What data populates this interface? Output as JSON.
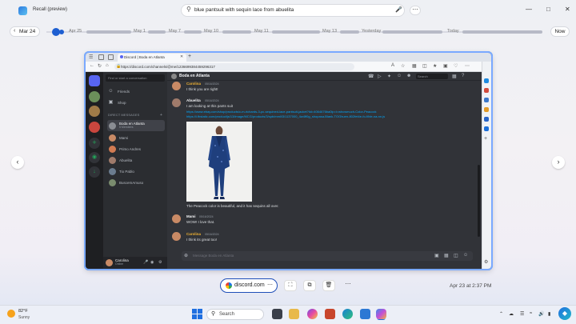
{
  "recall": {
    "app_title": "Recall (preview)",
    "search_query": "blue pantsuit with sequin lace from abuelita",
    "window_controls": [
      "minimize",
      "restore",
      "close"
    ]
  },
  "timeline": {
    "back_label": "Mar 24",
    "labels": [
      "Apr 25",
      "May 1",
      "May 7",
      "May 10",
      "May 11",
      "May 13",
      "Yesterday",
      "Today"
    ],
    "now_label": "Now"
  },
  "browser": {
    "tab_title": "Discord | Boda en Atlanta",
    "url": "https://discord.com/channels/@me/1236699384459296317"
  },
  "discord": {
    "find_placeholder": "Find or start a conversation",
    "nav": [
      {
        "label": "Friends",
        "icon": "friends-icon"
      },
      {
        "label": "Shop",
        "icon": "shop-icon"
      }
    ],
    "dm_header": "DIRECT MESSAGES",
    "dms": [
      {
        "label": "Boda en Atlanta",
        "sub": "5 Members",
        "color": "#8a8d93",
        "active": true
      },
      {
        "label": "Mami",
        "color": "#c98a65"
      },
      {
        "label": "Primo Andres",
        "color": "#d27b52"
      },
      {
        "label": "Abuelita",
        "color": "#a07b6b"
      },
      {
        "label": "Tio Pablo",
        "color": "#6b7c8f"
      },
      {
        "label": "BuscemAmuso",
        "color": "#7a8c6e"
      }
    ],
    "user": {
      "name": "Carolina",
      "status": "Online"
    },
    "channel_title": "Boda en Atlanta",
    "search_placeholder": "Search",
    "messages": [
      {
        "name": "Carolina",
        "time": "05/16/2024",
        "text": "I think you are right!",
        "color": "#c98a65"
      },
      {
        "name": "Abuelita",
        "time": "05/16/2024",
        "text": "I am looking at this pants suit",
        "link1": "https://www.ebay.com/shop/products/c-m-richards-3-pc-sequined-lace-pantsuit-jacket?iid=4064676ba0lp=i=whcwmuch-Color-Peacock",
        "link2": "https://i.fbstatic.com/product/js/13/image/MCG/products/3/spb/mml/l3/1137000_4w4ff0g_shopasa-Blank-TOGhuen-802fet4e-fo-f/ble-na-nn.js",
        "color": "#a07b6b"
      },
      {
        "caption": "The Peacock color is beautiful, and it has sequins all over."
      },
      {
        "name": "Mami",
        "time": "05/16/2024",
        "text": "WOW! I love that.",
        "color": "#c98a65"
      },
      {
        "name": "Carolina",
        "time": "05/16/2024",
        "text": "I think its great too!",
        "color": "#c98a65"
      }
    ],
    "composer_placeholder": "Message Boda en Atlanta"
  },
  "actions": {
    "site_label": "discord.com",
    "timestamp": "Apr 23 at 2:37 PM"
  },
  "taskbar": {
    "weather_temp": "82°F",
    "weather_desc": "Sunny",
    "search_label": "Search"
  },
  "colors": {
    "accent": "#1f4fb8",
    "discord_bg": "#313338",
    "link": "#00a8fc"
  }
}
